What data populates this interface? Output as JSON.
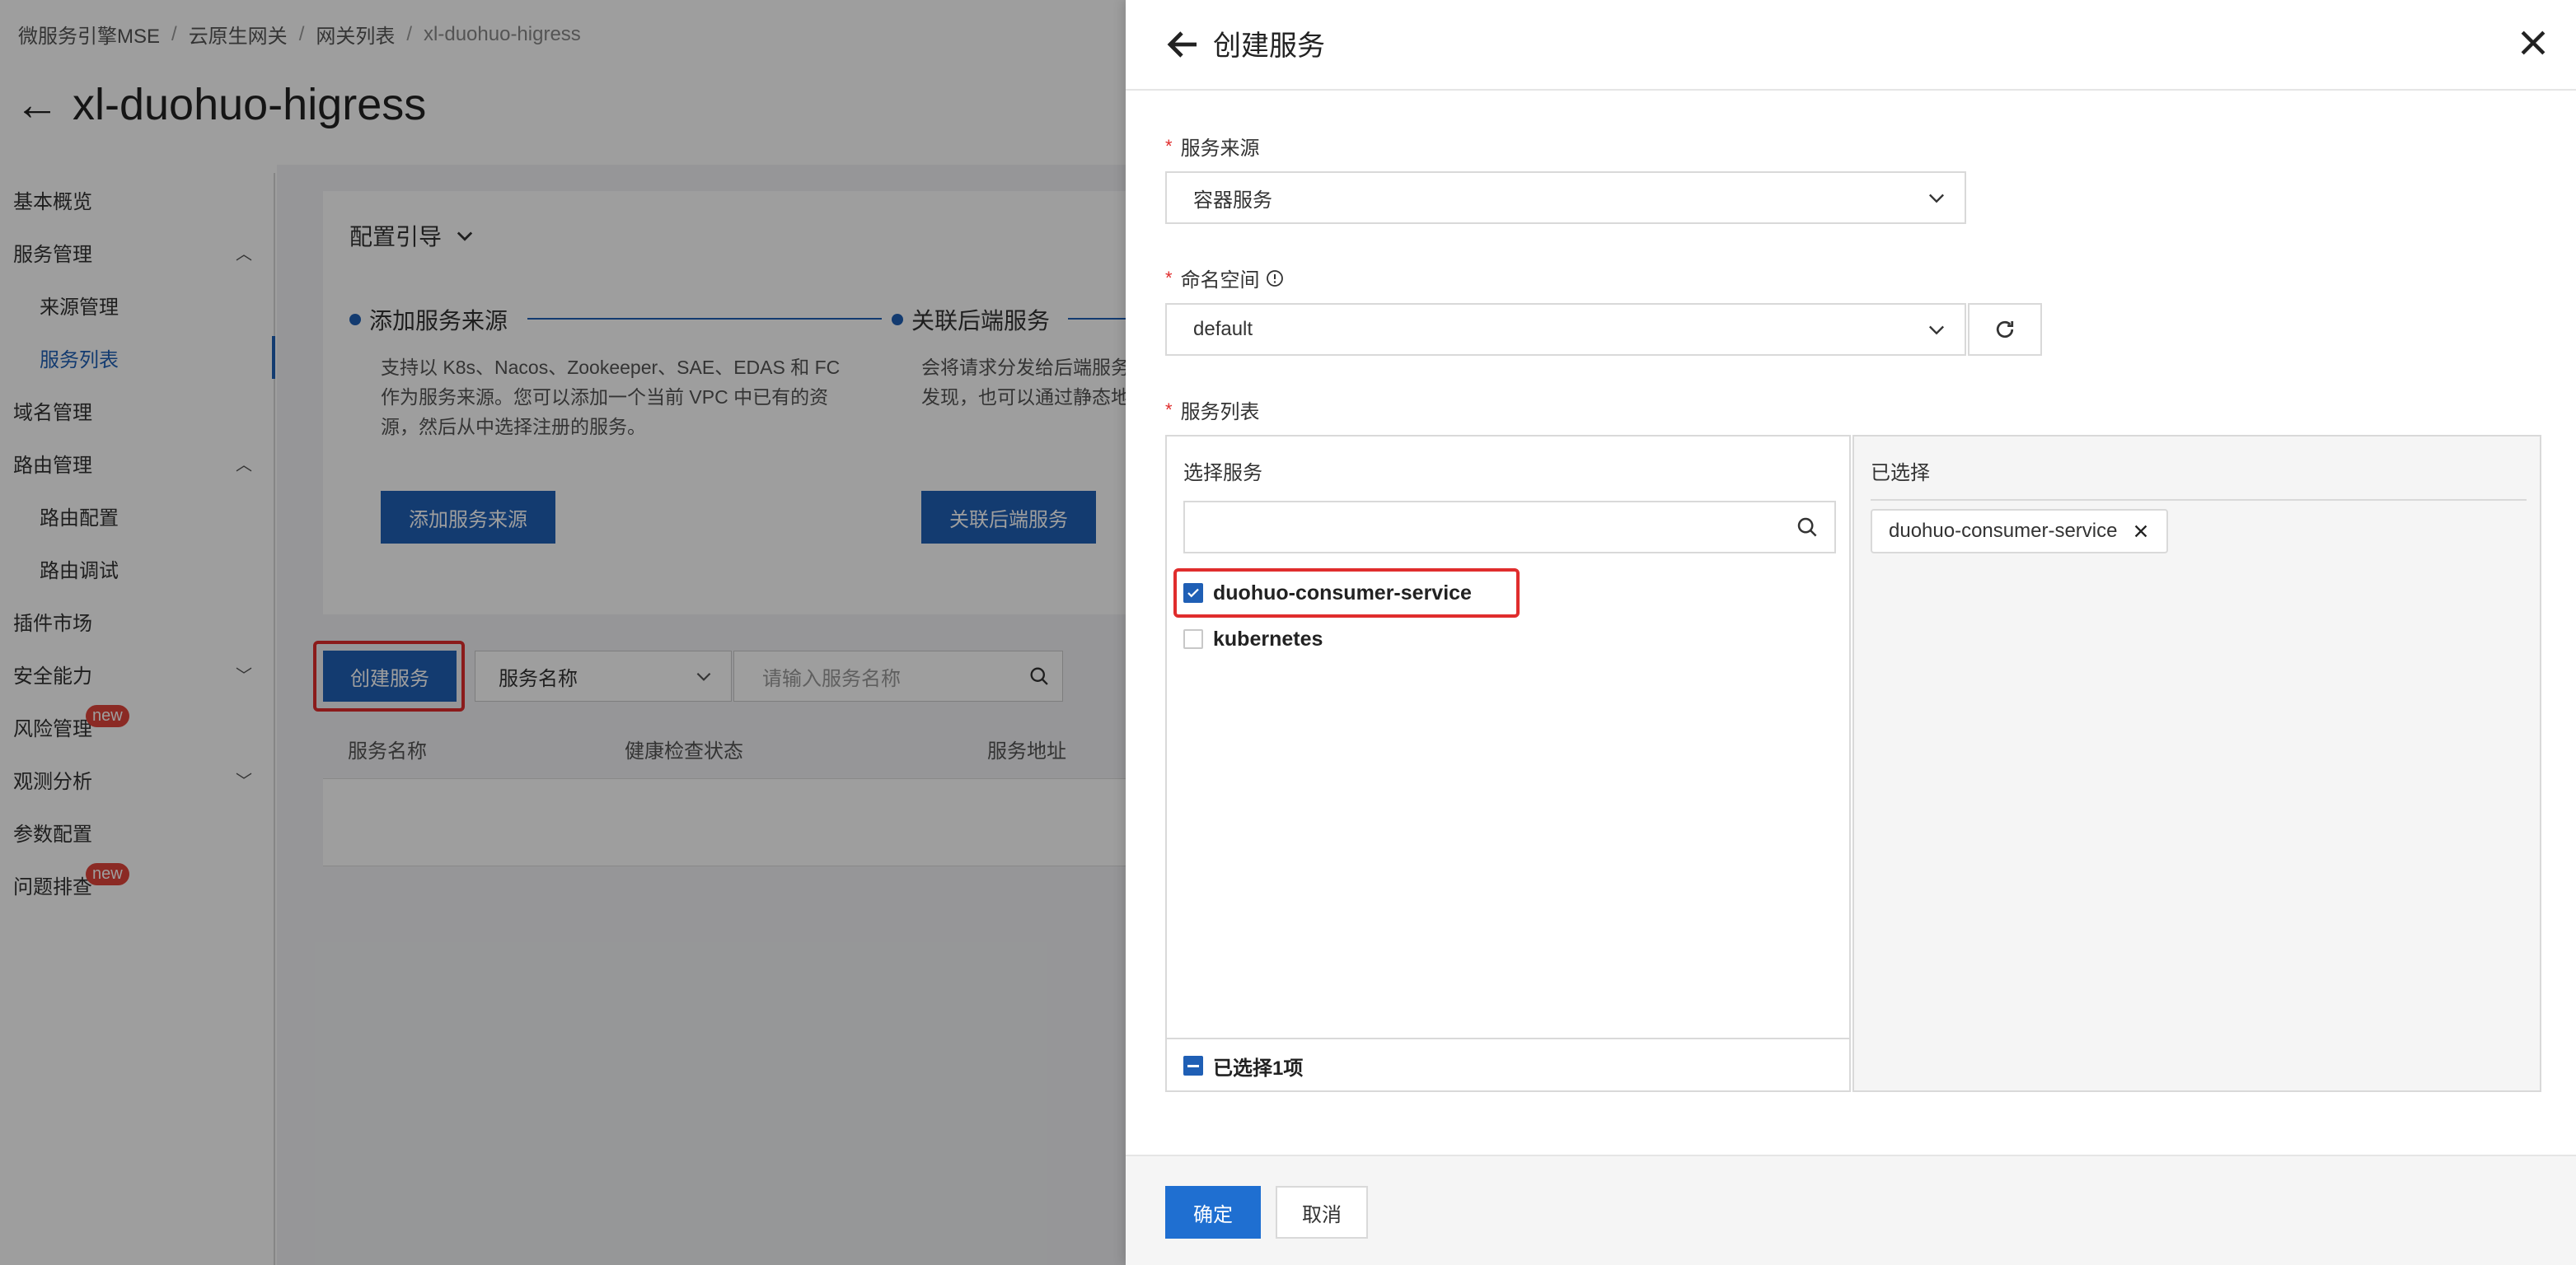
{
  "breadcrumb": [
    "微服务引擎MSE",
    "云原生网关",
    "网关列表",
    "xl-duohuo-higress"
  ],
  "page_title": "xl-duohuo-higress",
  "sidebar": {
    "items": [
      {
        "label": "基本概览"
      },
      {
        "label": "服务管理"
      },
      {
        "label": "来源管理"
      },
      {
        "label": "服务列表"
      },
      {
        "label": "域名管理"
      },
      {
        "label": "路由管理"
      },
      {
        "label": "路由配置"
      },
      {
        "label": "路由调试"
      },
      {
        "label": "插件市场"
      },
      {
        "label": "安全能力"
      },
      {
        "label": "风险管理",
        "badge": "new"
      },
      {
        "label": "观测分析"
      },
      {
        "label": "参数配置"
      },
      {
        "label": "问题排查",
        "badge": "new"
      }
    ]
  },
  "guide": {
    "title": "配置引导",
    "step1": {
      "title": "添加服务来源",
      "desc": [
        "支持以 K8s、Nacos、Zookeeper、SAE、EDAS 和 FC",
        "作为服务来源。您可以添加一个当前 VPC 中已有的资",
        "源，然后从中选择注册的服务。"
      ],
      "button": "添加服务来源"
    },
    "step2": {
      "title": "关联后端服务",
      "desc": [
        "会将请求分发给后端服务",
        "发现，也可以通过静态地"
      ],
      "button": "关联后端服务"
    }
  },
  "toolbar": {
    "create_button": "创建服务",
    "filter_select": "服务名称",
    "search_placeholder": "请输入服务名称"
  },
  "table": {
    "columns": [
      "服务名称",
      "健康检查状态",
      "服务地址"
    ]
  },
  "drawer": {
    "title": "创建服务",
    "source": {
      "label": "服务来源",
      "value": "容器服务"
    },
    "namespace": {
      "label": "命名空间",
      "value": "default"
    },
    "service_list": {
      "label": "服务列表",
      "left_title": "选择服务",
      "items": [
        {
          "name": "duohuo-consumer-service",
          "checked": true
        },
        {
          "name": "kubernetes",
          "checked": false
        }
      ],
      "footer": "已选择1项",
      "right_title": "已选择",
      "selected": [
        "duohuo-consumer-service"
      ]
    },
    "ok": "确定",
    "cancel": "取消"
  },
  "colors": {
    "primary": "#1f5fb5",
    "ok_button": "#1f6fd1",
    "highlight": "#e02d2d",
    "badge": "#e0443a"
  }
}
